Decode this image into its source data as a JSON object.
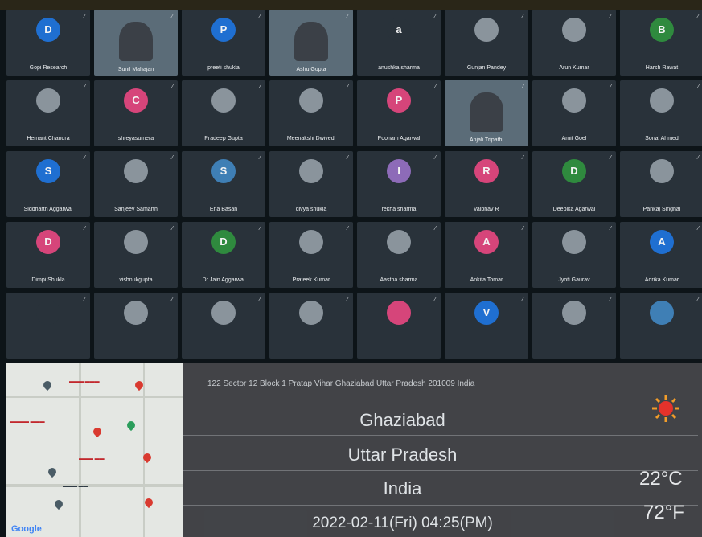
{
  "colors": {
    "tile_bg": "#29323a",
    "overlay": "#46484c",
    "text": "#dfe3e6"
  },
  "participants": [
    {
      "name": "Gopi Research",
      "initial": "D",
      "color": "#1f6fd1"
    },
    {
      "name": "Sunil Mahajan",
      "video": true
    },
    {
      "name": "preeti shukla",
      "initial": "P",
      "color": "#1f6fd1"
    },
    {
      "name": "Ashu Gupta",
      "video": true
    },
    {
      "name": "anushka sharma",
      "initial": "a",
      "color": "#29323a"
    },
    {
      "name": "Gunjan Pandey",
      "avatar": true
    },
    {
      "name": "Arun Kumar",
      "avatar": true
    },
    {
      "name": "Harsh Rawat",
      "initial": "B",
      "color": "#2f8a3e"
    },
    {
      "name": "Hemant Chandra",
      "avatar": true
    },
    {
      "name": "shreyasumera",
      "initial": "C",
      "color": "#d6457a"
    },
    {
      "name": "Pradeep Gupta",
      "avatar": true
    },
    {
      "name": "Meenakshi Dwivedi",
      "avatar": true
    },
    {
      "name": "Poonam Agarwal",
      "initial": "P",
      "color": "#d6457a"
    },
    {
      "name": "Anjali Tripathi",
      "video": true
    },
    {
      "name": "Amit Goel",
      "avatar": true
    },
    {
      "name": "Sonal Ahmed",
      "avatar": true
    },
    {
      "name": "Siddharth Aggarwal",
      "initial": "S",
      "color": "#1f6fd1"
    },
    {
      "name": "Sanjeev Samarth",
      "avatar": true
    },
    {
      "name": "Ena Basan",
      "initial": "S",
      "color": "#3f7fb5"
    },
    {
      "name": "divya shukla",
      "avatar": true
    },
    {
      "name": "rekha sharma",
      "initial": "I",
      "color": "#8d6bb8"
    },
    {
      "name": "vaibhav R",
      "initial": "R",
      "color": "#d6457a"
    },
    {
      "name": "Deepika Agarwal",
      "initial": "D",
      "color": "#2f8a3e"
    },
    {
      "name": "Pankaj Singhal",
      "avatar": true
    },
    {
      "name": "Dimpi Shukla",
      "initial": "D",
      "color": "#d6457a"
    },
    {
      "name": "vishnukgupta",
      "avatar": true
    },
    {
      "name": "Dr Jain Aggarwal",
      "initial": "D",
      "color": "#2f8a3e"
    },
    {
      "name": "Prateek Kumar",
      "avatar": true
    },
    {
      "name": "Aastha sharma",
      "avatar": true
    },
    {
      "name": "Ankita Tomar",
      "initial": "A",
      "color": "#d6457a"
    },
    {
      "name": "Jyoti Gaurav",
      "avatar": true
    },
    {
      "name": "Adrika Kumar",
      "initial": "A",
      "color": "#1f6fd1"
    },
    {
      "name": "",
      "initial": "",
      "color": "#29323a"
    },
    {
      "name": "",
      "avatar": true
    },
    {
      "name": "",
      "avatar": true
    },
    {
      "name": "",
      "avatar": true
    },
    {
      "name": "",
      "initial": "",
      "color": "#d6457a"
    },
    {
      "name": "",
      "initial": "V",
      "color": "#1f6fd1"
    },
    {
      "name": "",
      "avatar": true
    },
    {
      "name": "",
      "initial": "",
      "color": "#3f7fb5"
    }
  ],
  "location": {
    "address": "122 Sector 12 Block 1 Pratap Vihar Ghaziabad Uttar Pradesh 201009 India",
    "city": "Ghaziabad",
    "state": "Uttar Pradesh",
    "country": "India",
    "datetime": "2022-02-11(Fri)  04:25(PM)",
    "temp_c": "22°C",
    "temp_f": "72°F"
  },
  "map": {
    "brand": "Google"
  }
}
